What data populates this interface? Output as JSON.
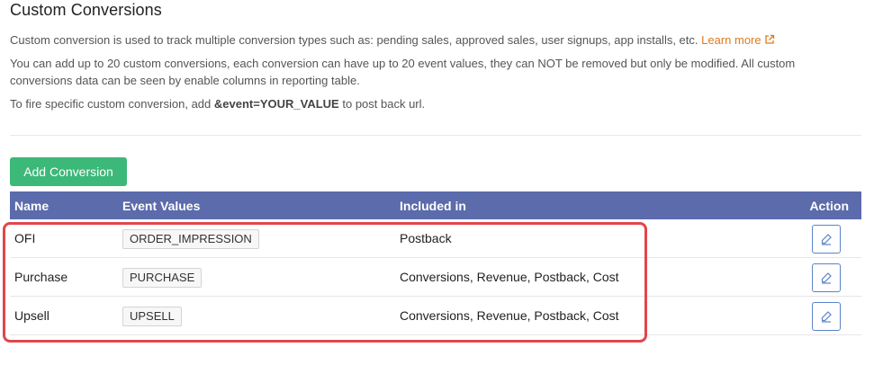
{
  "page": {
    "title": "Custom Conversions",
    "desc1": "Custom conversion is used to track multiple conversion types such as: pending sales, approved sales, user signups, app installs, etc.",
    "learn_more": "Learn more",
    "desc2": "You can add up to 20 custom conversions, each conversion can have up to 20 event values, they can NOT be removed but only be modified. All custom conversions data can be seen by enable columns in reporting table.",
    "desc3_prefix": "To fire specific custom conversion, add",
    "desc3_param": "&event=YOUR_VALUE",
    "desc3_suffix": "to post back url."
  },
  "add_button": "Add Conversion",
  "table": {
    "headers": {
      "name": "Name",
      "event_values": "Event Values",
      "included_in": "Included in",
      "action": "Action"
    },
    "rows": [
      {
        "name": "OFI",
        "event": "ORDER_IMPRESSION",
        "included": "Postback"
      },
      {
        "name": "Purchase",
        "event": "PURCHASE",
        "included": "Conversions, Revenue, Postback, Cost"
      },
      {
        "name": "Upsell",
        "event": "UPSELL",
        "included": "Conversions, Revenue, Postback, Cost"
      }
    ]
  },
  "icons": {
    "external_link": "external-link-icon",
    "edit": "pencil-edit-icon"
  },
  "colors": {
    "header_bg": "#5b6bab",
    "add_button_bg": "#3cb878",
    "link": "#e07a1f",
    "highlight": "#e0474c"
  }
}
